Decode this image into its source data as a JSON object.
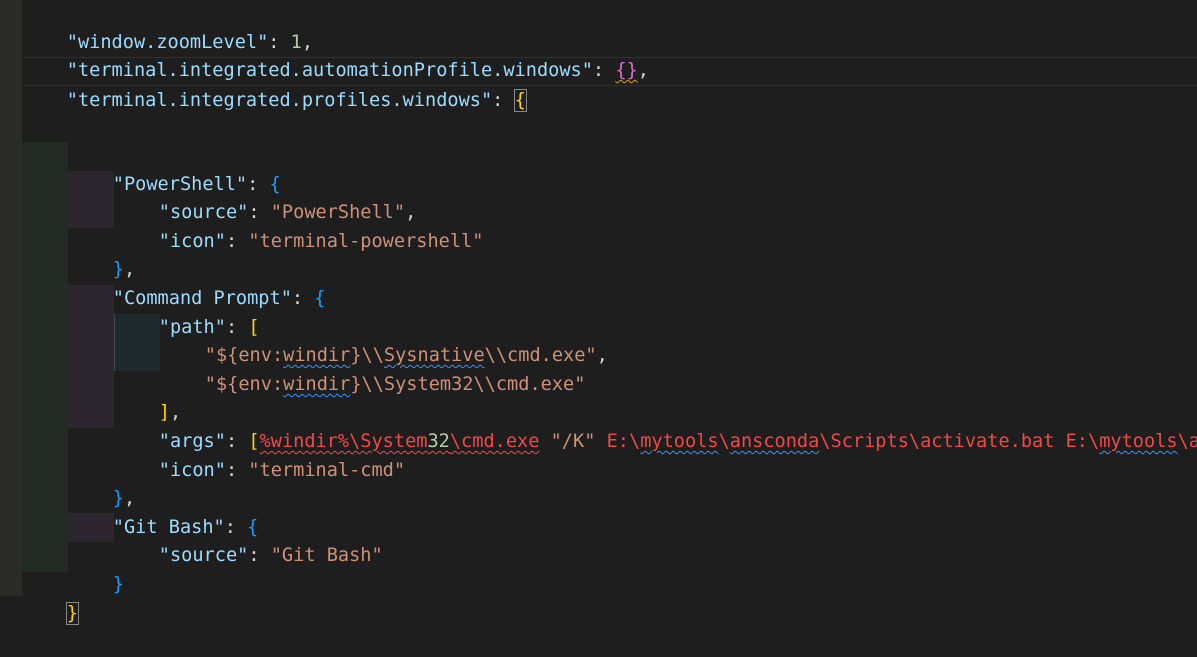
{
  "editor": {
    "lines": {
      "l1": {
        "key": "\"window.zoomLevel\"",
        "colon": ": ",
        "num": "1",
        "tail": ","
      },
      "l2": {
        "key": "\"terminal.integrated.automationProfile.windows\"",
        "colon": ": ",
        "brackets": "{}",
        "tail": ","
      },
      "l3": {
        "key": "\"terminal.integrated.profiles.windows\"",
        "colon": ": ",
        "open": "{"
      },
      "l6": {
        "key": "\"PowerShell\"",
        "colon": ": ",
        "open": "{"
      },
      "l7": {
        "key": "\"source\"",
        "colon": ": ",
        "value": "\"PowerShell\"",
        "tail": ","
      },
      "l8": {
        "key": "\"icon\"",
        "colon": ": ",
        "value": "\"terminal-powershell\""
      },
      "l9": {
        "close": "}",
        "tail": ","
      },
      "l10": {
        "key": "\"Command Prompt\"",
        "colon": ": ",
        "open": "{"
      },
      "l11": {
        "key": "\"path\"",
        "colon": ": ",
        "open": "["
      },
      "l12": {
        "pre": "\"${env:",
        "squig": "windir",
        "mid": "}\\\\",
        "squig2": "Sysnative",
        "post": "\\\\cmd.exe\"",
        "tail": ","
      },
      "l13": {
        "pre": "\"${env:",
        "squig": "windir",
        "post": "}\\\\System32\\\\cmd.exe\""
      },
      "l14": {
        "close": "]",
        "tail": ","
      },
      "l15": {
        "key": "\"args\"",
        "colon": ": ",
        "open": "[",
        "err1": "%windir%\\System",
        "err1num": "32",
        "err1tail": "\\cmd.exe",
        "s1": " \"/K\" ",
        "rest_a": "E:\\",
        "sq_a": "mytools",
        "rest_b": "\\",
        "sq_b": "ansconda",
        "rest_c": "\\Scripts\\activate.bat E:\\",
        "sq_c": "mytools",
        "rest_d": "\\a"
      },
      "l16": {
        "key": "\"icon\"",
        "colon": ": ",
        "value": "\"terminal-cmd\""
      },
      "l17": {
        "close": "}",
        "tail": ","
      },
      "l18": {
        "key": "\"Git Bash\"",
        "colon": ": ",
        "open": "{"
      },
      "l19": {
        "key": "\"source\"",
        "colon": ": ",
        "value": "\"Git Bash\""
      },
      "l20": {
        "close": "}"
      },
      "l21": {
        "close": "}"
      }
    }
  }
}
